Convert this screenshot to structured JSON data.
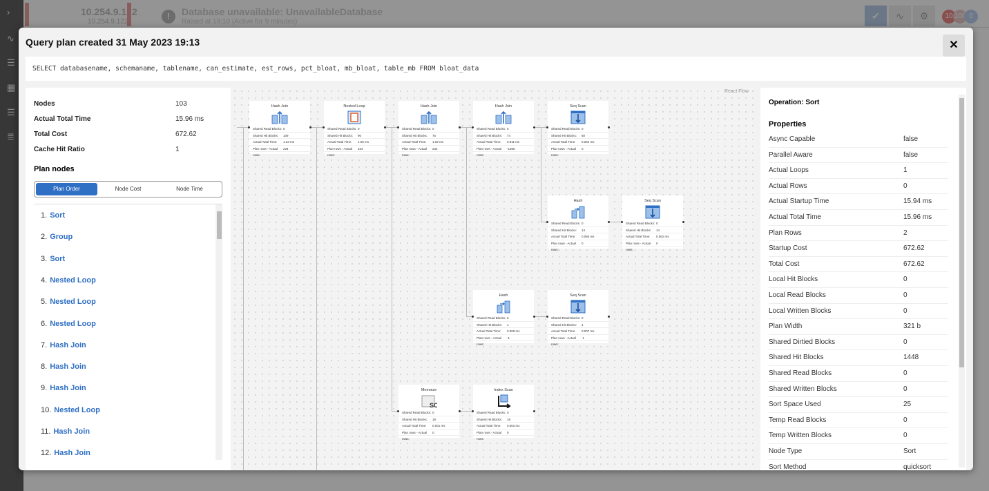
{
  "topbar": {
    "host": "10.254.9.122",
    "host_sub": "10.254.9.122",
    "alert_title": "Database unavailable: UnavailableDatabase",
    "alert_sub": "Raised at 19:10 (Active for 9 minutes)",
    "badges": [
      "10",
      "100",
      "0"
    ]
  },
  "modal": {
    "title": "Query plan created 31 May 2023 19:13",
    "close": "✕",
    "sql": "SELECT databasename, schemaname, tablename, can_estimate, est_rows, pct_bloat, mb_bloat, table_mb FROM bloat_data"
  },
  "summary": [
    {
      "label": "Nodes",
      "value": "103"
    },
    {
      "label": "Actual Total Time",
      "value": "15.96 ms"
    },
    {
      "label": "Total Cost",
      "value": "672.62"
    },
    {
      "label": "Cache Hit Ratio",
      "value": "1"
    }
  ],
  "plan_nodes": {
    "heading": "Plan nodes",
    "tabs": [
      "Plan Order",
      "Node Cost",
      "Node Time"
    ],
    "items": [
      {
        "n": "1.",
        "label": "Sort"
      },
      {
        "n": "2.",
        "label": "Group"
      },
      {
        "n": "3.",
        "label": "Sort"
      },
      {
        "n": "4.",
        "label": "Nested Loop"
      },
      {
        "n": "5.",
        "label": "Nested Loop"
      },
      {
        "n": "6.",
        "label": "Nested Loop"
      },
      {
        "n": "7.",
        "label": "Hash Join"
      },
      {
        "n": "8.",
        "label": "Hash Join"
      },
      {
        "n": "9.",
        "label": "Hash Join"
      },
      {
        "n": "10.",
        "label": "Nested Loop"
      },
      {
        "n": "11.",
        "label": "Hash Join"
      },
      {
        "n": "12.",
        "label": "Hash Join"
      }
    ]
  },
  "flow": {
    "attribution": "React Flow",
    "row_labels": [
      "Shared Read Blocks:",
      "Shared Hit Blocks:",
      "Actual Total Time:",
      "Plan rows - Actual rows:"
    ],
    "nodes": [
      {
        "title": "Hash Join",
        "icon": "hash-join",
        "values": [
          "0",
          "109",
          "1.23 ms",
          "234"
        ]
      },
      {
        "title": "Nested Loop",
        "icon": "nested-loop",
        "values": [
          "0",
          "90",
          "1.06 ms",
          "234"
        ]
      },
      {
        "title": "Hash Join",
        "icon": "hash-join",
        "values": [
          "0",
          "75",
          "1.02 ms",
          "234"
        ]
      },
      {
        "title": "Hash Join",
        "icon": "hash-join",
        "values": [
          "0",
          "74",
          "0.911 ms",
          "-1366"
        ]
      },
      {
        "title": "Seq Scan",
        "icon": "seq-scan",
        "values": [
          "0",
          "60",
          "0.264 ms",
          "0"
        ]
      },
      {
        "title": "Hash",
        "icon": "hash",
        "values": [
          "0",
          "14",
          "0.065 ms",
          "0"
        ]
      },
      {
        "title": "Seq Scan",
        "icon": "seq-scan",
        "values": [
          "0",
          "14",
          "0.062 ms",
          "0"
        ]
      },
      {
        "title": "Hash",
        "icon": "hash",
        "values": [
          "0",
          "1",
          "0.009 ms",
          "-1"
        ]
      },
      {
        "title": "Seq Scan",
        "icon": "seq-scan",
        "values": [
          "0",
          "1",
          "0.007 ms",
          "-1"
        ]
      },
      {
        "title": "Memoize",
        "icon": "memoize",
        "values": [
          "0",
          "18",
          "0.001 ms",
          "0"
        ]
      },
      {
        "title": "Index Scan",
        "icon": "index-scan",
        "values": [
          "0",
          "18",
          "0.003 ms",
          "0"
        ]
      }
    ]
  },
  "details": {
    "operation": "Operation: Sort",
    "heading": "Properties",
    "props": [
      [
        "Async Capable",
        "false"
      ],
      [
        "Parallel Aware",
        "false"
      ],
      [
        "Actual Loops",
        "1"
      ],
      [
        "Actual Rows",
        "0"
      ],
      [
        "Actual Startup Time",
        "15.94 ms"
      ],
      [
        "Actual Total Time",
        "15.96 ms"
      ],
      [
        "Plan Rows",
        "2"
      ],
      [
        "Startup Cost",
        "672.62"
      ],
      [
        "Total Cost",
        "672.62"
      ],
      [
        "Local Hit Blocks",
        "0"
      ],
      [
        "Local Read Blocks",
        "0"
      ],
      [
        "Local Written Blocks",
        "0"
      ],
      [
        "Plan Width",
        "321 b"
      ],
      [
        "Shared Dirtied Blocks",
        "0"
      ],
      [
        "Shared Hit Blocks",
        "1448"
      ],
      [
        "Shared Read Blocks",
        "0"
      ],
      [
        "Shared Written Blocks",
        "0"
      ],
      [
        "Sort Space Used",
        "25"
      ],
      [
        "Temp Read Blocks",
        "0"
      ],
      [
        "Temp Written Blocks",
        "0"
      ],
      [
        "Node Type",
        "Sort"
      ],
      [
        "Sort Method",
        "quicksort"
      ]
    ]
  },
  "colors": {
    "accent": "#2f6fc4",
    "alert": "#e8a0a0",
    "nested_loop": "#e0622a"
  }
}
